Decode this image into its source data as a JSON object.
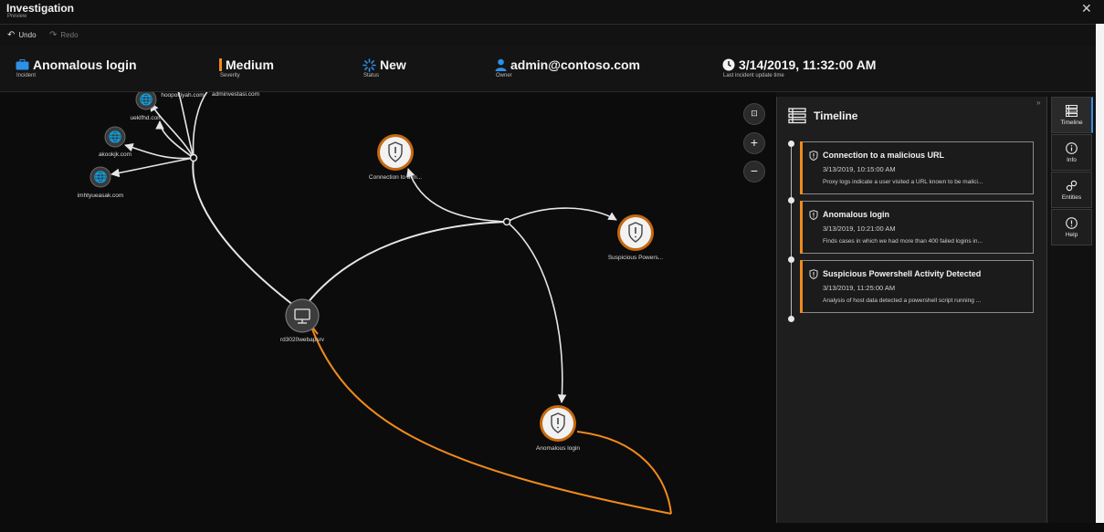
{
  "window": {
    "title": "Investigation",
    "subtitle": "Preview",
    "close_label": "✕"
  },
  "toolbar": {
    "undo_label": "Undo",
    "redo_label": "Redo"
  },
  "incident": {
    "name": "Anomalous login",
    "name_label": "Incident",
    "severity": "Medium",
    "severity_label": "Severity",
    "severity_color": "#f08a1b",
    "status": "New",
    "status_label": "Status",
    "owner": "admin@contoso.com",
    "owner_label": "Owner",
    "updated": "3/14/2019, 11:32:00 AM",
    "updated_label": "Last incident update time"
  },
  "graph": {
    "nodes": [
      {
        "id": "domain-1",
        "label": "hoopoitiyah.com",
        "icon": "globe-icon"
      },
      {
        "id": "domain-2",
        "label": "ueklfhd.com",
        "icon": "globe-icon"
      },
      {
        "id": "domain-3",
        "label": "akookjk.com",
        "icon": "globe-icon"
      },
      {
        "id": "domain-4",
        "label": "imhtyueasak.com",
        "icon": "globe-icon"
      },
      {
        "id": "domain-5",
        "label": "adminvestasi.com",
        "icon": "globe-icon"
      },
      {
        "id": "alert-connection",
        "label": "Connection to a m...",
        "icon": "alert-shield-icon"
      },
      {
        "id": "alert-powershell",
        "label": "Suspicious Powers...",
        "icon": "alert-shield-icon"
      },
      {
        "id": "host",
        "label": "rd3020webapsrv",
        "icon": "computer-icon"
      },
      {
        "id": "alert-anomalous",
        "label": "Anomalous login",
        "icon": "alert-shield-icon"
      }
    ],
    "accent_color": "#f08a1b",
    "edge_color": "#e6e6e6"
  },
  "zoom": {
    "fit_label": "⊡",
    "zoom_in_label": "+",
    "zoom_out_label": "−"
  },
  "timeline": {
    "title": "Timeline",
    "collapse_label": "»",
    "items": [
      {
        "title": "Connection to a malicious URL",
        "date": "3/13/2019, 10:15:00 AM",
        "desc": "Proxy logs indicate a user visited a URL known to be malici..."
      },
      {
        "title": "Anomalous login",
        "date": "3/13/2019, 10:21:00 AM",
        "desc": "Finds cases in which we had more than 400 failed logins in..."
      },
      {
        "title": "Suspicious Powershell Activity Detected",
        "date": "3/13/2019, 11:25:00 AM",
        "desc": "Analysis of host data detected a powershell script running ..."
      }
    ]
  },
  "rail": {
    "timeline_label": "Timeline",
    "info_label": "Info",
    "entities_label": "Entities",
    "help_label": "Help"
  }
}
